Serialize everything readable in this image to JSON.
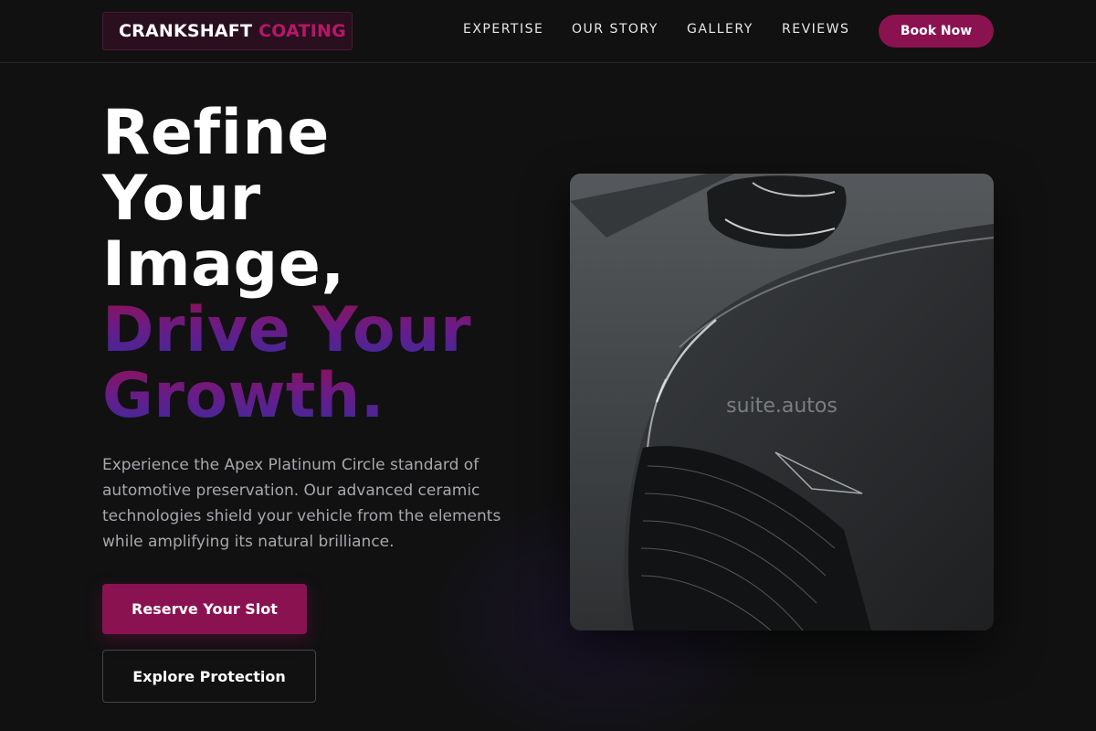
{
  "brand": {
    "word1": "CRANKSHAFT",
    "word2": "COATING"
  },
  "nav": {
    "items": [
      "EXPERTISE",
      "OUR STORY",
      "GALLERY",
      "REVIEWS"
    ],
    "cta": "Book Now"
  },
  "hero": {
    "title_line1": "Refine",
    "title_line2": "Your",
    "title_line3": "Image,",
    "title_line4": "Drive Your",
    "title_line5": "Growth.",
    "description": "Experience the Apex Platinum Circle standard of automotive preservation. Our advanced ceramic technologies shield your vehicle from the elements while amplifying its natural brilliance.",
    "primary_cta": "Reserve Your Slot",
    "secondary_cta": "Explore Protection"
  },
  "image": {
    "watermark": "suite.autos"
  },
  "colors": {
    "accent": "#8b1250",
    "brand_pink": "#b5176a",
    "gradient_end": "#3c2a9e",
    "background": "#111112"
  }
}
